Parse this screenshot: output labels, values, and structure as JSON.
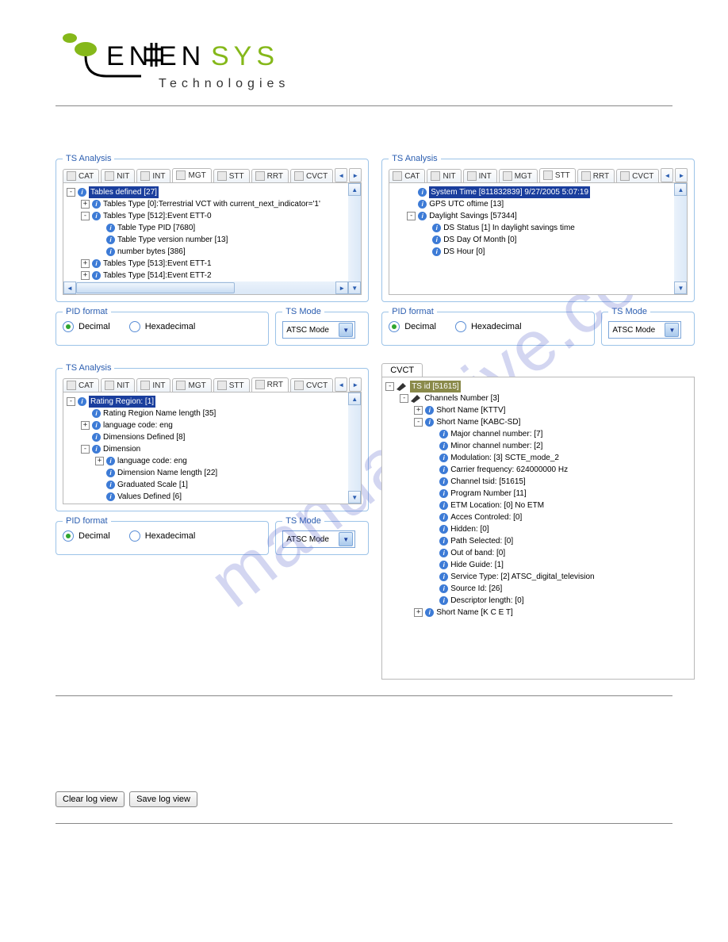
{
  "logo": {
    "brand_left": "ENEN",
    "brand_right": "SYS",
    "sub": "Technologies"
  },
  "watermark": "manualshive.com",
  "common": {
    "panel_title": "TS Analysis",
    "pid_title": "PID format",
    "ts_mode_title": "TS Mode",
    "radio_decimal": "Decimal",
    "radio_hex": "Hexadecimal",
    "ts_mode_value": "ATSC Mode",
    "tabs": {
      "cat": "CAT",
      "nit": "NIT",
      "int": "INT",
      "mgt": "MGT",
      "stt": "STT",
      "rrt": "RRT",
      "cvct": "CVCT"
    },
    "scroll_left": "◄",
    "scroll_right": "►"
  },
  "p_mgt": {
    "active_tab": "mgt",
    "tree": {
      "root": "Tables defined [27]",
      "n1": "Tables Type [0]:Terrestrial VCT with current_next_indicator='1'",
      "n2": "Tables Type [512]:Event ETT-0",
      "n2a": "Table Type PID [7680]",
      "n2b": "Table Type version number [13]",
      "n2c": "number bytes [386]",
      "n3": "Tables Type [513]:Event ETT-1",
      "n4": "Tables Type [514]:Event ETT-2"
    }
  },
  "p_stt": {
    "active_tab": "stt",
    "tree": {
      "n1": "System Time [811832839]  9/27/2005  5:07:19",
      "n2": "GPS UTC oftime [13]",
      "n3": "Daylight Savings [57344]",
      "n3a": "DS Status [1] In daylight savings time",
      "n3b": "DS Day Of Month [0]",
      "n3c": "DS Hour [0]"
    }
  },
  "p_rrt": {
    "active_tab": "rrt",
    "tree": {
      "root": "Rating Region: [1]",
      "n1": "Rating Region Name length [35]",
      "n2": "language code: eng",
      "n3": "Dimensions Defined [8]",
      "n4": "Dimension",
      "n4a": "language code: eng",
      "n4b": "Dimension Name length [22]",
      "n4c": "Graduated Scale [1]",
      "n4d": "Values Defined [6]"
    }
  },
  "p_cvct": {
    "tab_label": "CVCT",
    "tree": {
      "root": "TS id [51615]",
      "chn": "Channels Number [3]",
      "s1": "Short Name [KTTV]",
      "s2": "Short Name [KABC-SD]",
      "s2a": "Major channel number: [7]",
      "s2b": "Minor channel number: [2]",
      "s2c": "Modulation: [3] SCTE_mode_2",
      "s2d": "Carrier frequency: 624000000 Hz",
      "s2e": "Channel tsid: [51615]",
      "s2f": "Program Number [11]",
      "s2g": "ETM Location: [0] No ETM",
      "s2h": "Acces Controled: [0]",
      "s2i": "Hidden: [0]",
      "s2j": "Path Selected: [0]",
      "s2k": "Out of band: [0]",
      "s2l": "Hide Guide: [1]",
      "s2m": "Service Type: [2] ATSC_digital_television",
      "s2n": "Source Id: [26]",
      "s2o": "Descriptor length: [0]",
      "s3": "Short Name [K C E T]"
    }
  },
  "buttons": {
    "clear": "Clear log view",
    "save": "Save log view"
  }
}
